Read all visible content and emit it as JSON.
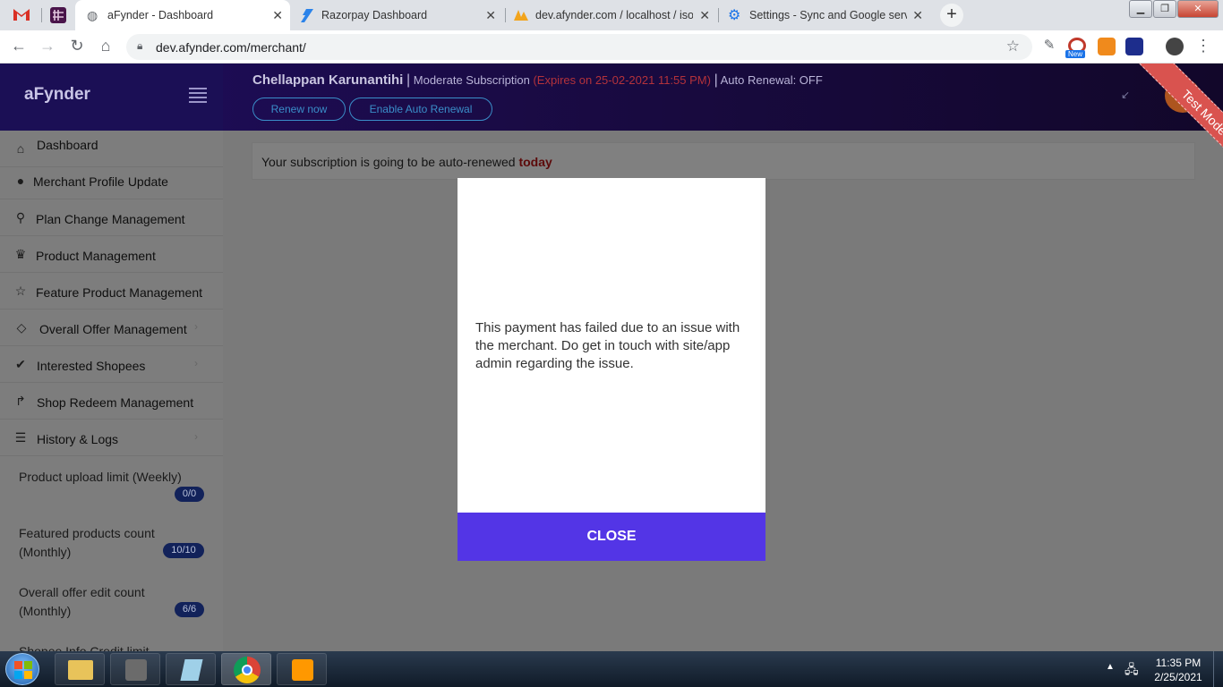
{
  "browser": {
    "tabs": [
      {
        "title": "aFynder - Dashboard",
        "active": true
      },
      {
        "title": "Razorpay Dashboard",
        "active": false
      },
      {
        "title": "dev.afynder.com / localhost / iso",
        "active": false
      },
      {
        "title": "Settings - Sync and Google servic",
        "active": false
      }
    ],
    "new_tab": "+",
    "close_glyph": "✕",
    "url": "dev.afynder.com/merchant/",
    "ext_new_badge": "New"
  },
  "app": {
    "brand": "aFynder",
    "merchant_name": "Chellappan Karunantihi",
    "separator": "|",
    "subscription": "Moderate Subscription",
    "expires": "(Expires on 25-02-2021 11:55 PM)",
    "auto_renewal": "Auto Renewal: OFF",
    "renew_button": "Renew now",
    "enable_auto_renewal_button": "Enable Auto Renewal",
    "ribbon": "Test Mode"
  },
  "sidebar": {
    "items": [
      {
        "label": "Dashboard",
        "icon": "home-icon"
      },
      {
        "label": "Merchant Profile Update",
        "icon": "user-icon"
      },
      {
        "label": "Plan Change Management",
        "icon": "search-icon"
      },
      {
        "label": "Product Management",
        "icon": "trophy-icon"
      },
      {
        "label": "Feature Product Management",
        "icon": "star-icon"
      },
      {
        "label": "Overall Offer Management",
        "icon": "diamond-icon"
      },
      {
        "label": "Interested Shopees",
        "icon": "check-icon"
      },
      {
        "label": "Shop Redeem Management",
        "icon": "share-icon"
      },
      {
        "label": "History & Logs",
        "icon": "list-icon"
      }
    ],
    "stats": [
      {
        "label": "Product upload limit (Weekly)",
        "badge": "0/0"
      },
      {
        "label": "Featured products count (Monthly)",
        "badge": "10/10"
      },
      {
        "label": "Overall offer edit count (Monthly)",
        "badge": "6/6"
      },
      {
        "label": "Shopee Info Credit limit",
        "badge": ""
      }
    ]
  },
  "notice": {
    "text": "Your subscription is going to be auto-renewed",
    "highlight": "today"
  },
  "modal": {
    "message": "This payment has failed due to an issue with the merchant. Do get in touch with site/app admin regarding the issue.",
    "close_label": "CLOSE"
  },
  "taskbar": {
    "time": "11:35 PM",
    "date": "2/25/2021"
  },
  "colors": {
    "modal_button": "#5335e6",
    "ribbon": "#d9534f",
    "header_bg": "#1a0b46",
    "expires_text": "#b4323b"
  }
}
